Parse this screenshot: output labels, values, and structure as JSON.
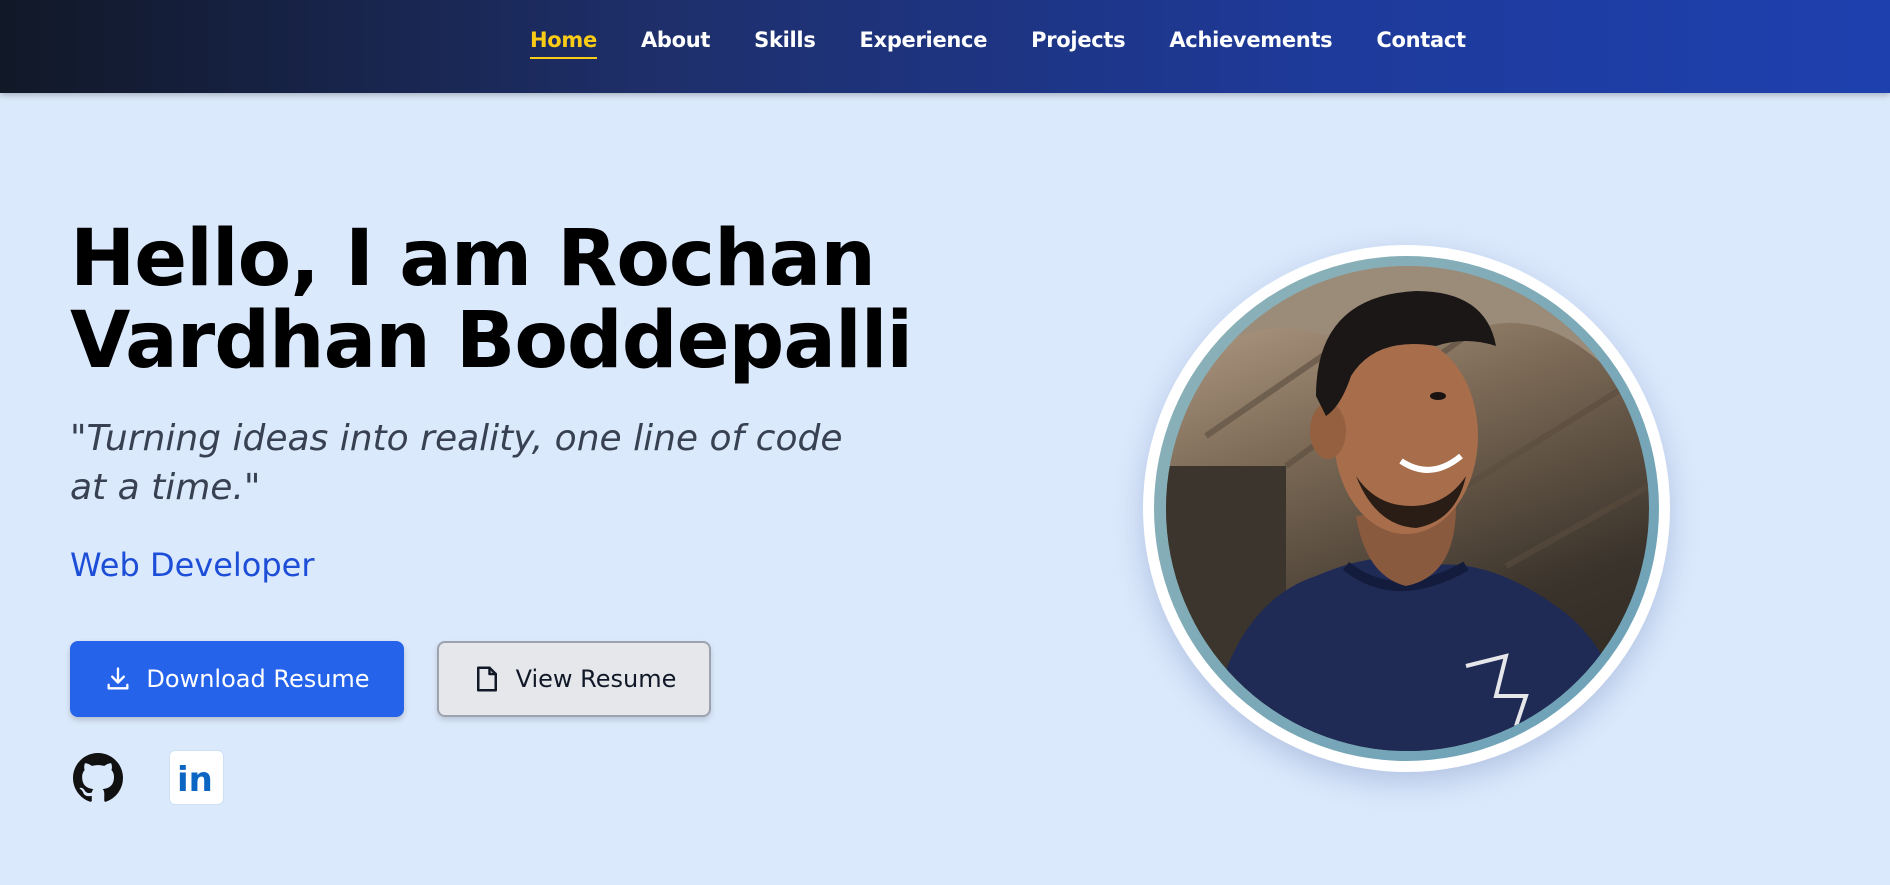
{
  "nav": {
    "items": [
      {
        "label": "Home",
        "active": true
      },
      {
        "label": "About",
        "active": false
      },
      {
        "label": "Skills",
        "active": false
      },
      {
        "label": "Experience",
        "active": false
      },
      {
        "label": "Projects",
        "active": false
      },
      {
        "label": "Achievements",
        "active": false
      },
      {
        "label": "Contact",
        "active": false
      }
    ]
  },
  "hero": {
    "title_line1": "Hello, I am Rochan",
    "title_line2": "Vardhan Boddepalli",
    "tagline": "\"Turning ideas into reality, one line of code at a time.\"",
    "role": "Web Developer",
    "download_label": "Download Resume",
    "view_label": "View Resume"
  },
  "social": {
    "github_icon": "github-icon",
    "linkedin_icon": "linkedin-icon"
  },
  "colors": {
    "nav_gradient_start": "#111827",
    "nav_gradient_end": "#1e40af",
    "active_link": "#facc15",
    "primary_button": "#2563eb",
    "role_text": "#1d4ed8",
    "page_background": "#dbe9fc"
  }
}
